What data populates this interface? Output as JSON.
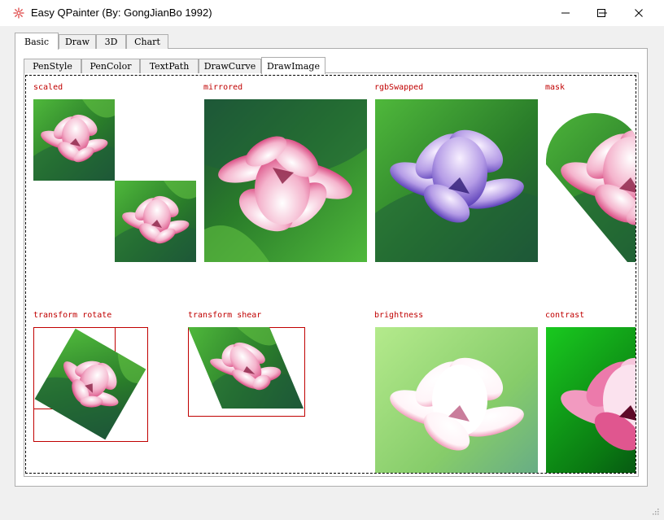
{
  "window": {
    "title": "Easy QPainter (By: GongJianBo 1992)"
  },
  "outer_tabs": [
    {
      "label": "Basic",
      "active": true
    },
    {
      "label": "Draw",
      "active": false
    },
    {
      "label": "3D",
      "active": false
    },
    {
      "label": "Chart",
      "active": false
    }
  ],
  "inner_tabs": [
    {
      "label": "PenStyle",
      "active": false
    },
    {
      "label": "PenColor",
      "active": false
    },
    {
      "label": "TextPath",
      "active": false
    },
    {
      "label": "DrawCurve",
      "active": false
    },
    {
      "label": "DrawImage",
      "active": true
    }
  ],
  "demos": {
    "scaled": "scaled",
    "mirrored": "mirrored",
    "rgb_swapped": "rgbSwapped",
    "mask": "mask",
    "transform_rotate": "transform rotate",
    "transform_shear": "transform shear",
    "brightness": "brightness",
    "contrast": "contrast"
  },
  "colors": {
    "label": "#c00000",
    "leaf": "#2f8a2b",
    "petal": "#f2a6c3"
  }
}
